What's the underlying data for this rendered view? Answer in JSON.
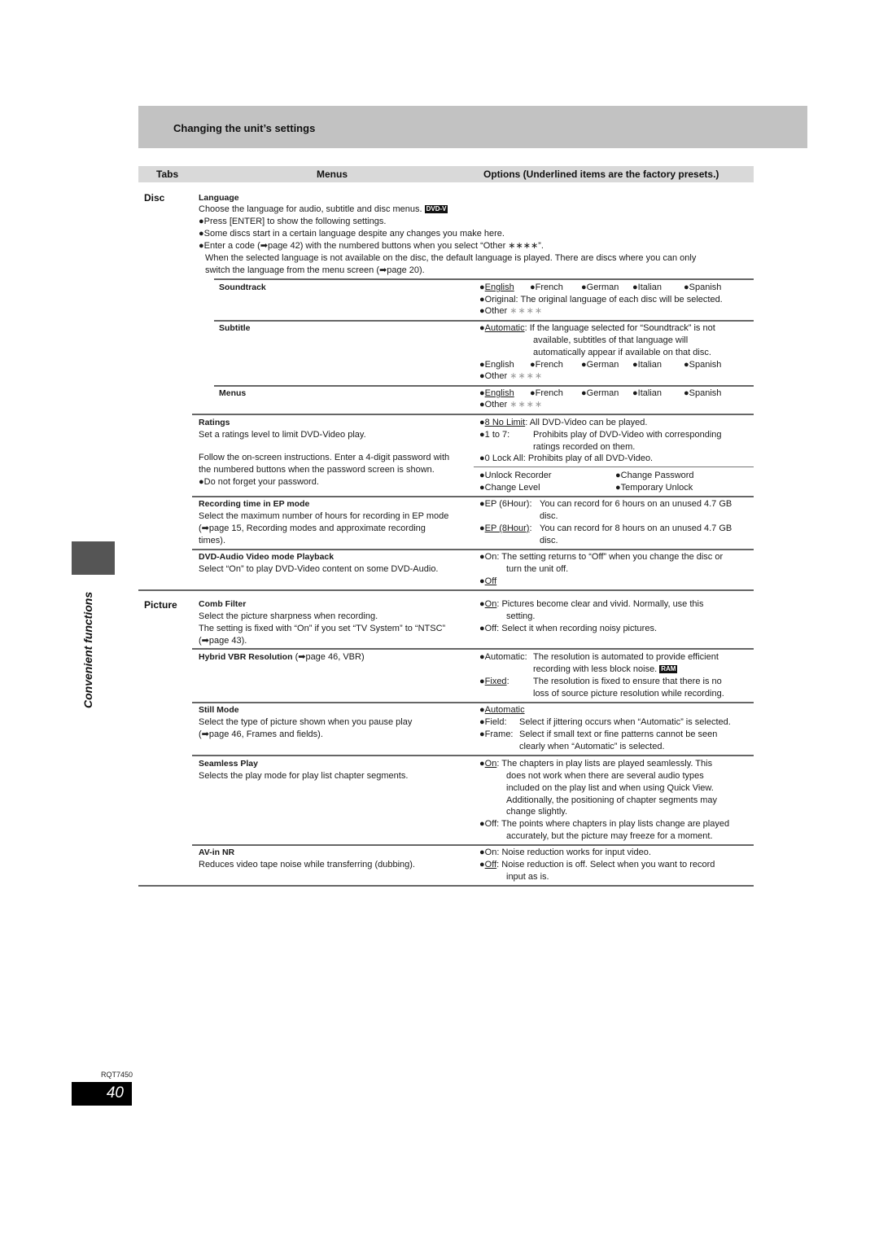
{
  "section_title": "Changing the unit’s settings",
  "table_header": {
    "tabs": "Tabs",
    "menus": "Menus",
    "options": "Options (Underlined items are the factory presets.)"
  },
  "side_label": "Convenient functions",
  "footer": {
    "doc_code": "RQT7450",
    "page_number": "40"
  },
  "bullet": "●",
  "stars": "∗∗∗∗",
  "tabs": {
    "disc": "Disc",
    "picture": "Picture"
  },
  "language": {
    "title": "Language",
    "desc": "Choose the language for audio, subtitle and disc menus.",
    "badge": "DVD-V",
    "notes": [
      "●Press [ENTER] to show the following settings.",
      "●Some discs start in a certain language despite any changes you make here.",
      "●Enter a code (➡page 42) with the numbered buttons when you select “Other ∗∗∗∗”."
    ],
    "para": [
      "When the selected language is not available on the disc, the default language is played. There are discs where you can only",
      "switch the language from the menu screen (➡page 20)."
    ],
    "submenus": {
      "soundtrack": {
        "name": "Soundtrack",
        "languages": [
          "English",
          "French",
          "German",
          "Italian",
          "Spanish"
        ],
        "default": "English",
        "original": "Original: The original language of each disc will be selected.",
        "other": "Other"
      },
      "subtitle": {
        "name": "Subtitle",
        "automatic_label": "Automatic",
        "automatic_text": [
          ": If the language selected for “Soundtrack” is not",
          "available, subtitles of that language will",
          "automatically appear if available on that disc."
        ],
        "languages": [
          "English",
          "French",
          "German",
          "Italian",
          "Spanish"
        ],
        "other": "Other"
      },
      "menus": {
        "name": "Menus",
        "languages": [
          "English",
          "French",
          "German",
          "Italian",
          "Spanish"
        ],
        "default": "English",
        "other": "Other"
      }
    }
  },
  "ratings": {
    "title": "Ratings",
    "desc": "Set a ratings level to limit DVD-Video play.",
    "follow": [
      "Follow the on-screen instructions. Enter a 4-digit password with",
      "the numbered buttons when the password screen is shown.",
      "●Do not forget your password."
    ],
    "options": [
      {
        "label": "8 No Limit",
        "default": true,
        "text": [
          "All DVD-Video can be played."
        ]
      },
      {
        "label": "1 to 7:",
        "default": false,
        "text": [
          "Prohibits play of DVD-Video with corresponding",
          "ratings recorded on them."
        ]
      },
      {
        "label": "0 Lock All:",
        "default": false,
        "text": [
          "Prohibits play of all DVD-Video."
        ]
      }
    ],
    "password_options": [
      "Unlock Recorder",
      "Change Password",
      "Change Level",
      "Temporary Unlock"
    ]
  },
  "ep_mode": {
    "title": "Recording time in EP mode",
    "desc": [
      "Select the maximum number of hours for recording in EP mode",
      "(➡page 15, Recording modes and approximate recording",
      "times)."
    ],
    "options": [
      {
        "label": "EP (6Hour):",
        "default": false,
        "text": [
          "You can record for 6 hours on an unused 4.7 GB",
          "disc."
        ]
      },
      {
        "label": "EP (8Hour)",
        "default": true,
        "text": [
          "You can record for 8 hours on an unused 4.7 GB",
          "disc."
        ]
      }
    ]
  },
  "dvd_audio": {
    "title": "DVD-Audio  Video mode Playback",
    "desc": "Select “On” to play DVD-Video content on some DVD-Audio.",
    "options": [
      {
        "label": "On:",
        "default": false,
        "text": [
          "The setting returns to “Off” when you change the disc or",
          "turn the unit off."
        ]
      },
      {
        "label": "Off",
        "default": true,
        "text": []
      }
    ]
  },
  "comb_filter": {
    "title": "Comb Filter",
    "desc": [
      "Select the picture sharpness when recording.",
      "The setting is fixed with “On” if you set “TV System” to “NTSC”",
      "(➡page 43)."
    ],
    "options": [
      {
        "label": "On",
        "default": true,
        "text": [
          "Pictures become clear and vivid. Normally, use this",
          "setting."
        ]
      },
      {
        "label": "Off:",
        "default": false,
        "text": [
          "Select it when recording noisy pictures."
        ]
      }
    ]
  },
  "hybrid_vbr": {
    "title": "Hybrid VBR Resolution",
    "ref": " (➡page 46, VBR)",
    "options": [
      {
        "label": "Automatic:",
        "default": false,
        "text": [
          "The resolution is automated to provide efficient",
          "recording with less block noise."
        ],
        "badge": "RAM"
      },
      {
        "label": "Fixed",
        "default": true,
        "text": [
          "The resolution is fixed to ensure that there is no",
          "loss of source picture resolution while recording."
        ]
      }
    ]
  },
  "still_mode": {
    "title": "Still Mode",
    "desc": [
      "Select the type of picture shown when you pause play",
      "(➡page 46, Frames and fields)."
    ],
    "options": [
      {
        "label": "Automatic",
        "default": true,
        "text": []
      },
      {
        "label": "Field:",
        "default": false,
        "text": [
          "Select if jittering occurs when “Automatic” is selected."
        ]
      },
      {
        "label": "Frame:",
        "default": false,
        "text": [
          "Select if small text or fine patterns cannot be seen",
          "clearly when “Automatic” is selected."
        ]
      }
    ]
  },
  "seamless_play": {
    "title": "Seamless Play",
    "desc": "Selects the play mode for play list chapter segments.",
    "options": [
      {
        "label": "On",
        "default": true,
        "text": [
          "The chapters in play lists are played seamlessly. This",
          "does not work when there are several audio types",
          "included on the play list and when using Quick View.",
          "Additionally, the positioning of chapter segments may",
          "change slightly."
        ]
      },
      {
        "label": "Off:",
        "default": false,
        "text": [
          "The points where chapters in play lists change are played",
          "accurately, but the picture may freeze for a moment."
        ]
      }
    ]
  },
  "av_in_nr": {
    "title": "AV-in NR",
    "desc": "Reduces video tape noise while transferring (dubbing).",
    "options": [
      {
        "label": "On:",
        "default": false,
        "text": [
          "Noise reduction works for input video."
        ]
      },
      {
        "label": "Off",
        "default": true,
        "text": [
          "Noise reduction is off. Select when you want to record",
          "input as is."
        ]
      }
    ]
  }
}
